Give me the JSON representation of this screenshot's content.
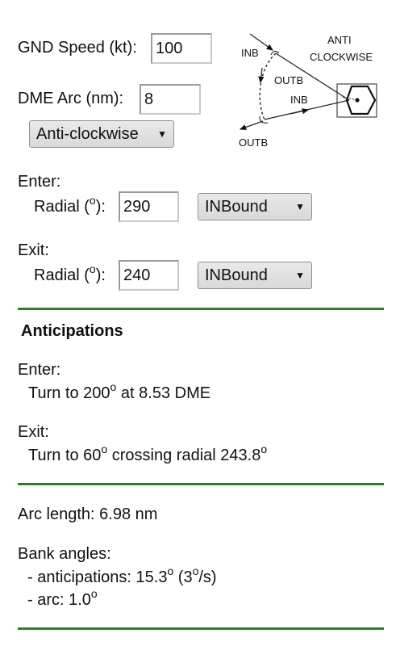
{
  "inputs": {
    "gnd_speed_label": "GND Speed (kt):",
    "gnd_speed_value": "100",
    "dme_arc_label": "DME Arc (nm):",
    "dme_arc_value": "8",
    "direction_selected": "Anti-clockwise"
  },
  "diagram": {
    "anti_label": "ANTI",
    "clockwise_label": "CLOCKWISE",
    "inb_top": "INB",
    "outb_mid": "OUTB",
    "inb_right": "INB",
    "outb_bottom": "OUTB"
  },
  "enter": {
    "heading": "Enter:",
    "radial_label": "Radial (",
    "radial_value": "290",
    "bound_selected": "INBound"
  },
  "exit": {
    "heading": "Exit:",
    "radial_label": "Radial (",
    "radial_value": "240",
    "bound_selected": "INBound"
  },
  "degree_symbol": "o",
  "radial_close": "):",
  "anticipations": {
    "title": "Anticipations",
    "enter_heading": "Enter:",
    "enter_turn_prefix": "Turn to 200",
    "enter_turn_suffix": " at 8.53 DME",
    "exit_heading": "Exit:",
    "exit_turn_prefix": "Turn to 60",
    "exit_turn_middle": " crossing radial 243.8"
  },
  "results": {
    "arc_length": "Arc length: 6.98 nm",
    "bank_heading": "Bank angles:",
    "bank_antic_prefix": "- anticipations: 15.3",
    "bank_antic_rate_open": " (3",
    "bank_antic_rate_close": "/s)",
    "bank_arc_prefix": "- arc: 1.0"
  },
  "colors": {
    "divider": "#2e7d2e"
  }
}
